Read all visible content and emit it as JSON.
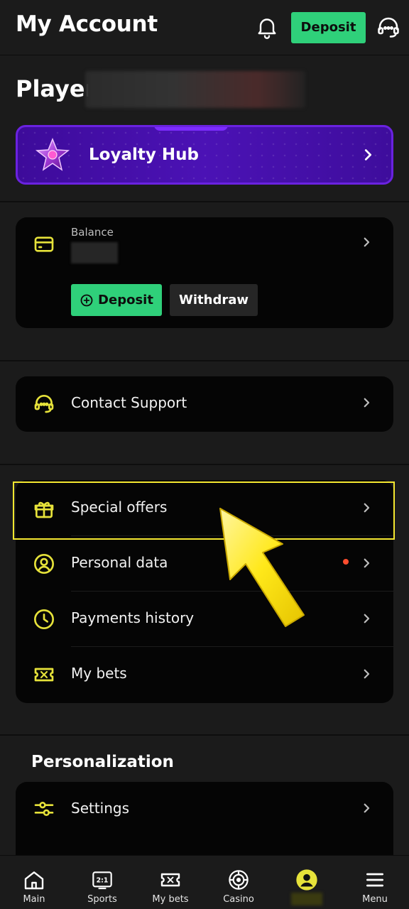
{
  "header": {
    "title": "My Account",
    "deposit_label": "Deposit",
    "icons": [
      "bell-icon",
      "support-headset-icon"
    ]
  },
  "player": {
    "prefix": "Player"
  },
  "loyalty": {
    "label": "Loyalty Hub",
    "icon": "star-icon"
  },
  "balance": {
    "label": "Balance",
    "deposit_label": "Deposit",
    "withdraw_label": "Withdraw",
    "icon": "wallet-card-icon"
  },
  "support": {
    "label": "Contact Support",
    "icon": "headset-icon"
  },
  "menu": {
    "items": [
      {
        "label": "Special offers",
        "icon": "gift-icon"
      },
      {
        "label": "Personal data",
        "icon": "user-circle-icon"
      },
      {
        "label": "Payments history",
        "icon": "clock-icon"
      },
      {
        "label": "My bets",
        "icon": "ticket-icon"
      }
    ]
  },
  "personalization": {
    "title": "Personalization",
    "items": [
      {
        "label": "Settings",
        "icon": "sliders-icon"
      }
    ]
  },
  "nav": {
    "items": [
      {
        "label": "Main",
        "icon": "home-icon"
      },
      {
        "label": "Sports",
        "icon": "scoreboard-icon"
      },
      {
        "label": "My bets",
        "icon": "ticket-icon"
      },
      {
        "label": "Casino",
        "icon": "roulette-icon"
      },
      {
        "label": "",
        "icon": "profile-icon"
      },
      {
        "label": "Menu",
        "icon": "hamburger-icon"
      }
    ]
  },
  "colors": {
    "accent_green": "#2fd07a",
    "icon_yellow": "#e6e23a",
    "loyalty_purple": "#4b12b5",
    "highlight_yellow": "#f5e830",
    "notification_red": "#ff4d2e"
  }
}
